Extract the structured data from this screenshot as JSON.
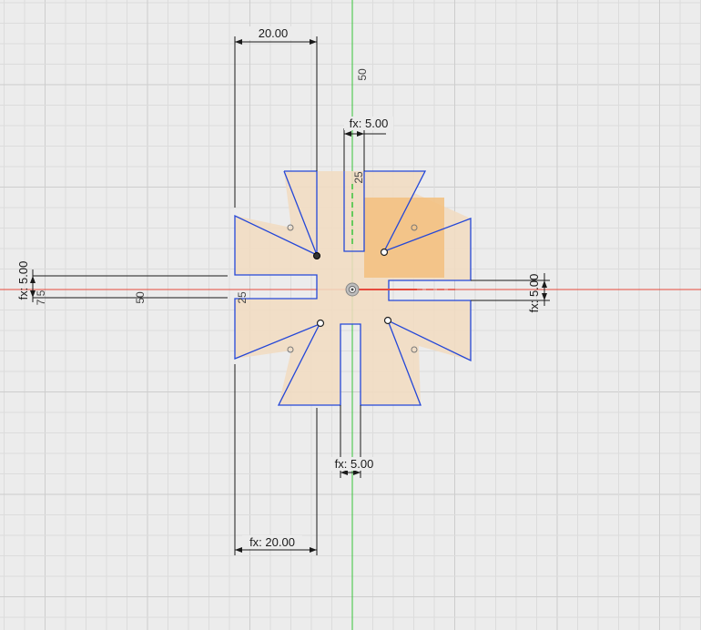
{
  "sketch": {
    "dimensions": {
      "top_width": "20.00",
      "bottom_width": "fx: 20.00",
      "top_slot": "fx: 5.00",
      "bottom_slot": "fx: 5.00",
      "left_slot": "fx: 5.00",
      "right_slot": "fx: 5.00",
      "vertical_50": "50",
      "vertical_25": "25",
      "horizontal_50": "50",
      "horizontal_25": "25",
      "small_75": "7.5"
    },
    "colors": {
      "background": "#ececec",
      "grid_minor": "#d9d9d9",
      "grid_major": "#cfcfcf",
      "axis_x": "#e64a3c",
      "axis_y": "#39c43a",
      "profile_fill": "#f2dcc1",
      "profile_line": "#2447d8",
      "selection_fill": "#f3c07e",
      "dimension_line": "#1a1a1a"
    }
  }
}
